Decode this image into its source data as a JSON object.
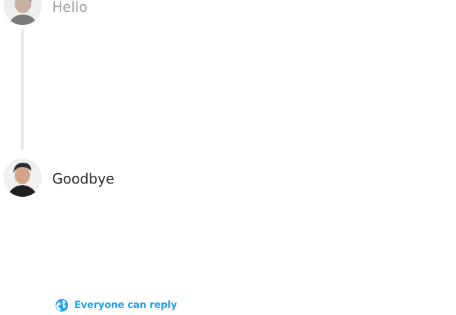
{
  "thread": {
    "tweets": [
      {
        "text": "Hello",
        "avatar_icon": "user-avatar-icon"
      },
      {
        "text": "Goodbye",
        "avatar_icon": "user-avatar-icon"
      }
    ]
  },
  "reply_settings": {
    "label": "Everyone can reply",
    "icon": "globe-icon",
    "color": "#1da1f2"
  },
  "colors": {
    "faded_text": "#9aa0a6",
    "active_text": "#2a2a2a",
    "thread_line": "#e1e8ed"
  }
}
